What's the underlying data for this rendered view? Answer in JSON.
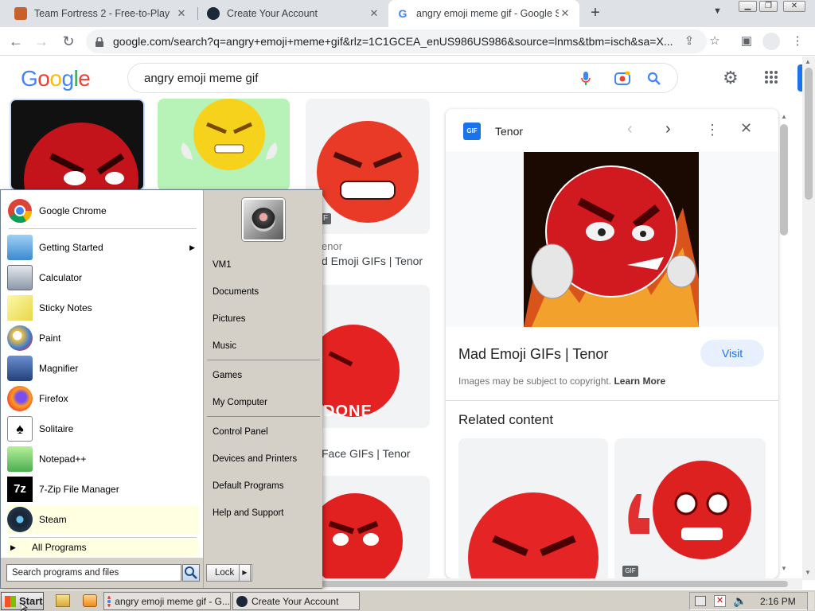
{
  "browser": {
    "tabs": [
      {
        "title": "Team Fortress 2 - Free-to-Play",
        "active": false
      },
      {
        "title": "Create Your Account",
        "active": false
      },
      {
        "title": "angry emoji meme gif - Google S",
        "active": true
      }
    ],
    "url": "google.com/search?q=angry+emoji+meme+gif&rlz=1C1GCEA_enUS986US986&source=lnms&tbm=isch&sa=X..."
  },
  "google": {
    "logo": "Google",
    "query": "angry emoji meme gif"
  },
  "results": {
    "col3_top": {
      "source": "enor",
      "title": "d Emoji GIFs | Tenor",
      "badge": "F"
    },
    "col3_mid": {
      "title": "Face GIFs | Tenor",
      "overlay": "DONE"
    }
  },
  "panel": {
    "source": "Tenor",
    "title": "Mad Emoji GIFs | Tenor",
    "visit": "Visit",
    "copyright": "Images may be subject to copyright.",
    "learn_more": "Learn More",
    "related": "Related content",
    "gif_badge": "GIF"
  },
  "start_menu": {
    "pinned": [
      "Google Chrome"
    ],
    "recent": [
      {
        "label": "Getting Started",
        "submenu": true
      },
      {
        "label": "Calculator"
      },
      {
        "label": "Sticky Notes"
      },
      {
        "label": "Paint"
      },
      {
        "label": "Magnifier"
      },
      {
        "label": "Firefox"
      },
      {
        "label": "Solitaire"
      },
      {
        "label": "Notepad++"
      },
      {
        "label": "7-Zip File Manager"
      },
      {
        "label": "Steam"
      }
    ],
    "all_programs": "All Programs",
    "search_placeholder": "Search programs and files",
    "right": {
      "group1": [
        "VM1",
        "Documents",
        "Pictures",
        "Music"
      ],
      "group2": [
        "Games",
        "My Computer"
      ],
      "group3": [
        "Control Panel",
        "Devices and Printers",
        "Default Programs",
        "Help and Support"
      ]
    },
    "lock": "Lock"
  },
  "taskbar": {
    "start": "Start",
    "windows": [
      "angry emoji meme gif - G...",
      "Create Your Account"
    ],
    "clock": "2:16 PM"
  }
}
